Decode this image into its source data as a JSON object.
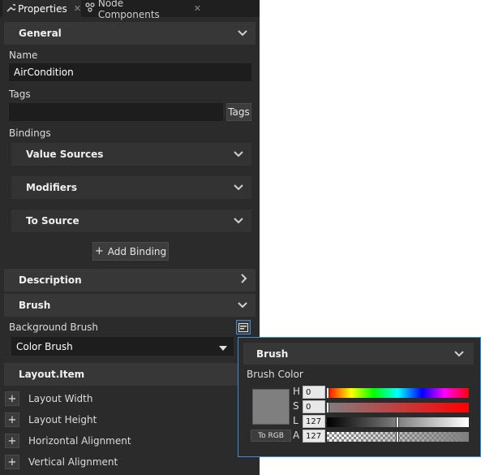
{
  "tabs": [
    {
      "label": "Properties",
      "icon": "wrench-icon"
    },
    {
      "label": "Node Components",
      "icon": "components-icon"
    }
  ],
  "tab_close_glyph": "✕",
  "general": {
    "title": "General",
    "name_label": "Name",
    "name_value": "AirCondition",
    "tags_label": "Tags",
    "tags_value": "",
    "tags_button": "Tags",
    "bindings_label": "Bindings",
    "binding_sections": [
      "Value Sources",
      "Modifiers",
      "To Source"
    ],
    "add_binding": "Add Binding"
  },
  "description": {
    "title": "Description"
  },
  "brush": {
    "title": "Brush",
    "background_label": "Background Brush",
    "brush_type": "Color Brush"
  },
  "layout_item": {
    "title": "Layout.Item",
    "rows": [
      "Layout Width",
      "Layout Height",
      "Horizontal Alignment",
      "Vertical Alignment"
    ]
  },
  "popup": {
    "title": "Brush",
    "color_label": "Brush Color",
    "to_rgb": "To RGB",
    "channels": [
      {
        "label": "H",
        "value": "0"
      },
      {
        "label": "S",
        "value": "0"
      },
      {
        "label": "L",
        "value": "127"
      },
      {
        "label": "A",
        "value": "127"
      }
    ],
    "color": "#7f7f7f",
    "accent": "#3a8ed9"
  }
}
